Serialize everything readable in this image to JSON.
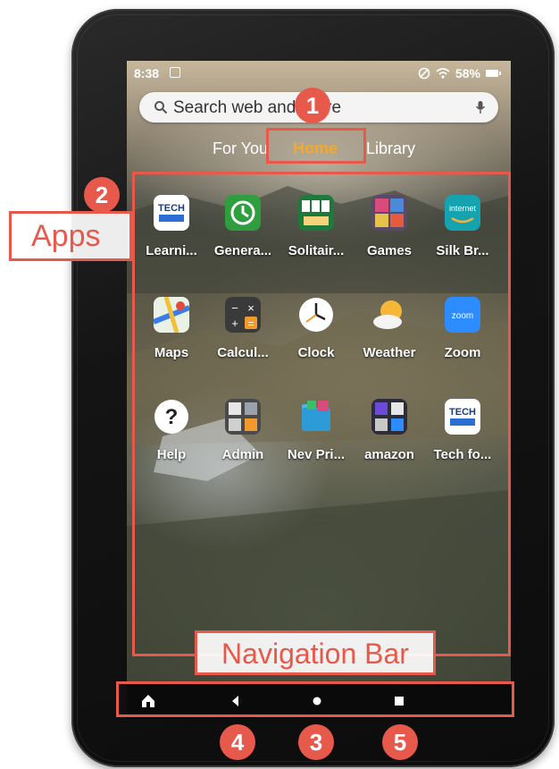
{
  "status_bar": {
    "time": "8:38",
    "battery": "58%"
  },
  "search": {
    "placeholder": "Search web and Store"
  },
  "tabs": [
    {
      "label": "For You"
    },
    {
      "label": "Home",
      "active": true
    },
    {
      "label": "Library"
    }
  ],
  "apps": [
    {
      "label": "Learni...",
      "icon": "tech-learning-icon"
    },
    {
      "label": "Genera...",
      "icon": "green-clock-icon"
    },
    {
      "label": "Solitair...",
      "icon": "solitaire-cards-icon"
    },
    {
      "label": "Games",
      "icon": "games-folder-icon"
    },
    {
      "label": "Silk Br...",
      "icon": "internet-browser-icon"
    },
    {
      "label": "Maps",
      "icon": "maps-icon"
    },
    {
      "label": "Calcul...",
      "icon": "calculator-icon"
    },
    {
      "label": "Clock",
      "icon": "clock-icon"
    },
    {
      "label": "Weather",
      "icon": "weather-icon"
    },
    {
      "label": "Zoom",
      "icon": "zoom-icon"
    },
    {
      "label": "Help",
      "icon": "help-icon"
    },
    {
      "label": "Admin",
      "icon": "admin-folder-icon"
    },
    {
      "label": "Nev Pri...",
      "icon": "folder-icon"
    },
    {
      "label": "amazon",
      "icon": "amazon-folder-icon"
    },
    {
      "label": "Tech fo...",
      "icon": "tech-for-icon"
    }
  ],
  "annotations": {
    "home_tab_number": "1",
    "apps_number": "2",
    "apps_label": "Apps",
    "nav_bar_label": "Navigation Bar",
    "home_button_number": "3",
    "back_button_number": "4",
    "recents_button_number": "5"
  },
  "colors": {
    "accent": "#f7a827",
    "annotation": "#e75a4b"
  }
}
